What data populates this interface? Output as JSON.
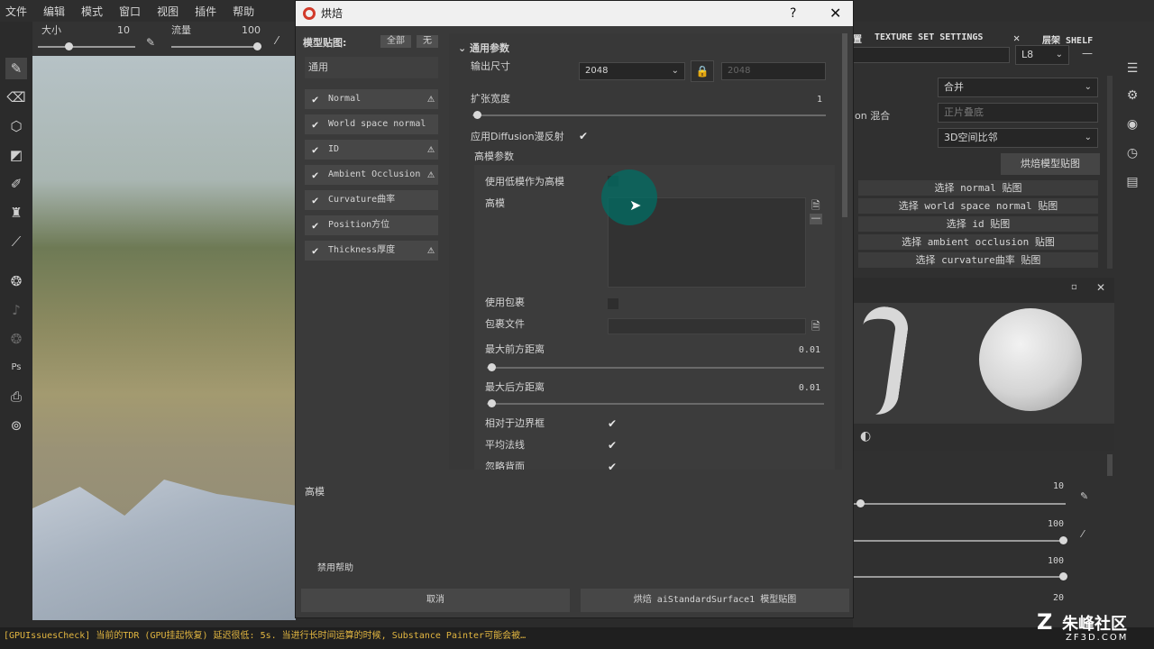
{
  "menu": [
    "文件",
    "编辑",
    "模式",
    "窗口",
    "视图",
    "插件",
    "帮助"
  ],
  "toolbar": {
    "size_label": "大小",
    "size_value": "10",
    "flow_label": "流量",
    "flow_value": "100"
  },
  "right_panel": {
    "header_left": "置",
    "header_title": "TEXTURE SET SETTINGS",
    "header_close": "✕",
    "header_right": "层架 SHELF",
    "dd_l8": "L8",
    "dd_merge": "合并",
    "label_mix": "on 混合",
    "dd_ortho": "正片叠底",
    "dd_3d": "3D空间比邻",
    "bake_button": "烘焙模型贴图",
    "select_buttons": [
      "选择 normal 贴图",
      "选择 world space normal 贴图",
      "选择 id 贴图",
      "选择 ambient occlusion 贴图",
      "选择 curvature曲率 贴图"
    ],
    "values": [
      "10",
      "100",
      "100",
      "20"
    ]
  },
  "dialog": {
    "title": "烘焙",
    "help": "?",
    "close": "✕",
    "mesh_maps_label": "模型贴图:",
    "all_button": "全部",
    "none_button": "无",
    "common_item": "通用",
    "maps": [
      {
        "label": "Normal",
        "warn": true
      },
      {
        "label": "World space normal",
        "warn": false
      },
      {
        "label": "ID",
        "warn": true
      },
      {
        "label": "Ambient Occlusion",
        "warn": true
      },
      {
        "label": "Curvature曲率",
        "warn": false
      },
      {
        "label": "Position方位",
        "warn": false
      },
      {
        "label": "Thickness厚度",
        "warn": true
      }
    ],
    "section_common": "通用参数",
    "output_size_label": "输出尺寸",
    "output_size_value": "2048",
    "output_size_locked": "2048",
    "dilation_label": "扩张宽度",
    "dilation_value": "1",
    "apply_diffusion_label": "应用Diffusion漫反射",
    "highpoly_section": "高模参数",
    "use_lowpoly_label": "使用低模作为高模",
    "highpoly_label": "高模",
    "use_cage_label": "使用包裹",
    "cage_file_label": "包裹文件",
    "max_front_label": "最大前方距离",
    "max_front_value": "0.01",
    "max_rear_label": "最大后方距离",
    "max_rear_value": "0.01",
    "relative_bbox_label": "相对于边界框",
    "average_normals_label": "平均法线",
    "ignore_backface_label": "忽略背面",
    "info_label": "高模",
    "disable_help": "禁用帮助",
    "cancel_button": "取消",
    "bake_button": "烘焙 aiStandardSurface1 模型贴图"
  },
  "status_text": "[GPUIssuesCheck] 当前的TDR (GPU挂起恢复) 延迟很低:  5s.  当进行长时间运算的时候, Substance Painter可能会被…",
  "watermark": {
    "brand": "朱峰社区",
    "site": "ZF3D.COM"
  }
}
